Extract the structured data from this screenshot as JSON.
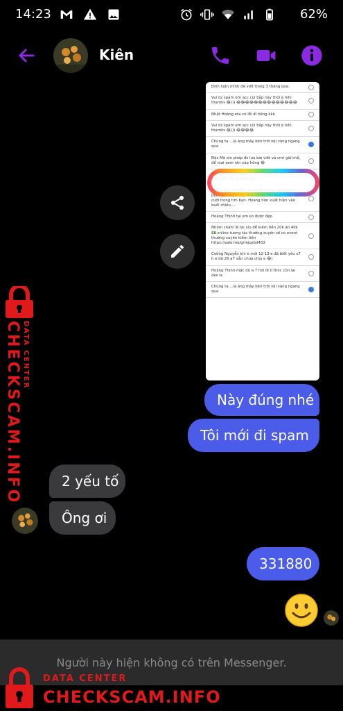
{
  "status_bar": {
    "time": "14:23",
    "battery_percent": "62%",
    "left_icons": [
      "gmail-icon",
      "alert-icon",
      "image-icon"
    ],
    "right_icons": [
      "alarm-icon",
      "vibrate-icon",
      "wifi-icon",
      "signal-icon",
      "battery-icon"
    ]
  },
  "header": {
    "contact_name": "Kiên",
    "accent_color": "#8a2be2"
  },
  "screenshot_items": [
    {
      "text": "bình luận mình đã viết trong 3 tháng qua.",
      "checked": false
    },
    {
      "text": "Vui dz spam em acc cùi bắp này thôi à hihi thamks 😂))) 😂😂😂😂😂😂😂😂😂😂😂😂😂😂",
      "checked": false
    },
    {
      "text": "Nhật Hoàng eta có lỗi đi riêng kkk",
      "checked": false
    },
    {
      "text": "Vui dz spam em acc cùi bắp này thôi à hihi thamks 😂))) 😂😂😂😂",
      "checked": false
    },
    {
      "text": "Chúng ta....là áng mây bên trời vội vàng ngang qua",
      "checked": true
    },
    {
      "text": "Độc Mã xin phép đc lưu bài viết và cmt giữ chỗ, để mai xem ntn vào hông 😂",
      "checked": false
    },
    {
      "text": "Mua via Nam Việt trên 500 ảnh Đẹp trai . Đủ điều kiện thì ib nèm link",
      "checked": false
    },
    {
      "text": "Bình minh bắt đầu vào buổi sáng, hạnh phúc ở bên cạnh bạn. Mặt Trời chiếu vào buổi trưa, nụ cười trong tim bạn. Hoàng hôn xuất hiện vào buổi chiều,...",
      "checked": false
    },
    {
      "text": "Hoàng Thịnh tại em ko được đẹp",
      "checked": false
    },
    {
      "text": "Nhóm chăm lề tài xỉu dễ kiếm tiền 20k ăn 40k 💵 online tương tác thường xuyên sẽ có event thường xuyên kiếm tiền https://zalo.me/g/rejqzbd433",
      "checked": false
    },
    {
      "text": "Cường Nguyễn khi e mới 12 13 e đã biết yêu s7 h e đã 26 a7 vẫn chưa chịu e 😂)",
      "checked": false
    },
    {
      "text": "Hoàng Thịnh mặc dù a 7 hơi đi tí thôi, còn lại oke la",
      "checked": false
    },
    {
      "text": "Chúng ta....là áng mây bên trời vội vàng ngang qua",
      "checked": true
    }
  ],
  "messages": {
    "out_1": "Này đúng nhé",
    "out_2": "Tôi mới đi spam",
    "in_1": "2 yếu tố",
    "in_2": "Ông ơi",
    "out_3": "331880",
    "emoji": "😊"
  },
  "footer": {
    "unavailable_text": "Người này hiện không có trên Messenger."
  },
  "watermark": {
    "brand": "CHECKSCAM.INFO",
    "subtitle": "DATA CENTER"
  }
}
